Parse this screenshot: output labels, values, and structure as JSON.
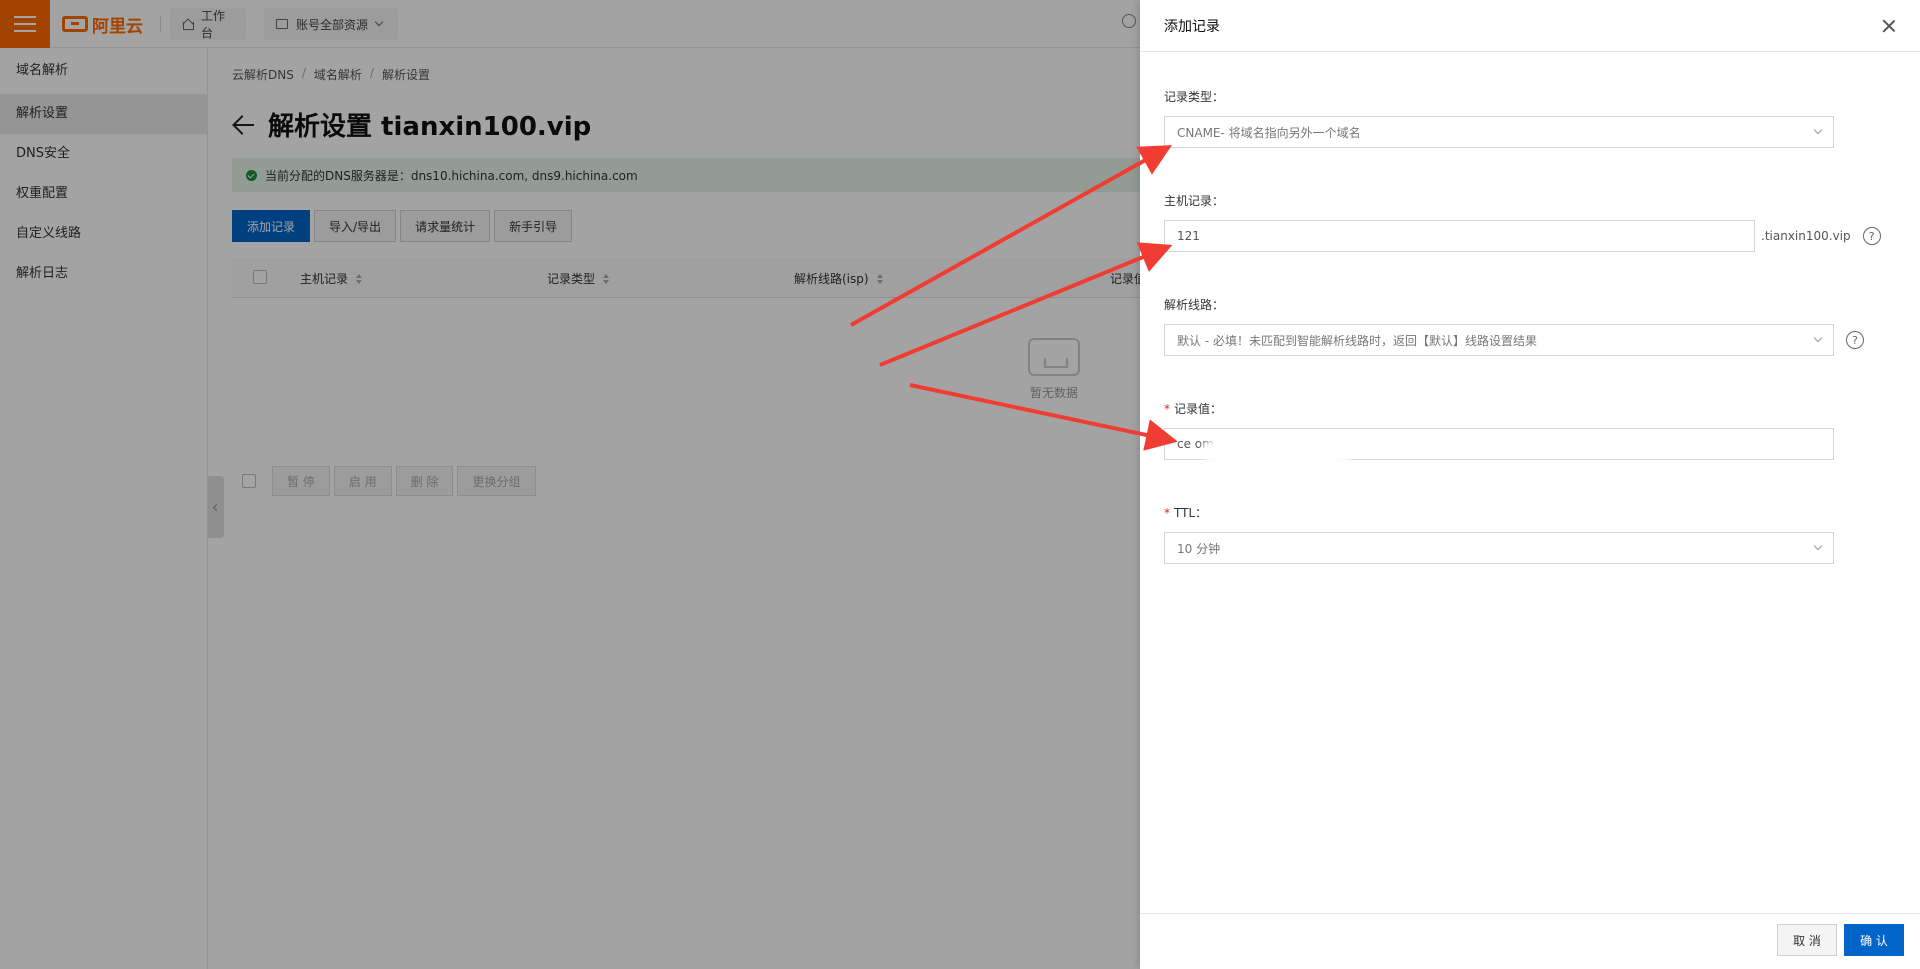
{
  "header": {
    "logo_text": "阿里云",
    "workbench_label": "工作台",
    "resource_label": "账号全部资源"
  },
  "sidebar": {
    "items": [
      {
        "label": "域名解析",
        "active": false
      },
      {
        "label": "解析设置",
        "active": true
      },
      {
        "label": "DNS安全",
        "active": false
      },
      {
        "label": "权重配置",
        "active": false
      },
      {
        "label": "自定义线路",
        "active": false
      },
      {
        "label": "解析日志",
        "active": false
      }
    ]
  },
  "breadcrumb": [
    "云解析DNS",
    "域名解析",
    "解析设置"
  ],
  "page": {
    "title": "解析设置 tianxin100.vip",
    "notice": "当前分配的DNS服务器是：dns10.hichina.com, dns9.hichina.com",
    "toolbar": [
      "添加记录",
      "导入/导出",
      "请求量统计",
      "新手引导"
    ],
    "columns": [
      "主机记录",
      "记录类型",
      "解析线路(isp)",
      "记录值"
    ],
    "empty_text": "暂无数据",
    "bulk_actions": [
      "暂 停",
      "启 用",
      "删 除",
      "更换分组"
    ]
  },
  "drawer": {
    "title": "添加记录",
    "record_type": {
      "label": "记录类型：",
      "value": "CNAME- 将域名指向另外一个域名"
    },
    "host": {
      "label": "主机记录：",
      "value": "121",
      "suffix": ".tianxin100.vip"
    },
    "line": {
      "label": "解析线路：",
      "value": "默认 - 必填！未匹配到智能解析线路时，返回【默认】线路设置结果"
    },
    "record_value": {
      "label": "记录值：",
      "value": "ce                                  om"
    },
    "ttl": {
      "label": "TTL：",
      "value": "10 分钟"
    },
    "cancel_label": "取 消",
    "confirm_label": "确 认",
    "help_glyph": "?"
  },
  "colors": {
    "brand": "#ff6a00",
    "primary": "#0064c8",
    "annotation": "#f03c32",
    "notice_bg": "#e4f5e8"
  }
}
